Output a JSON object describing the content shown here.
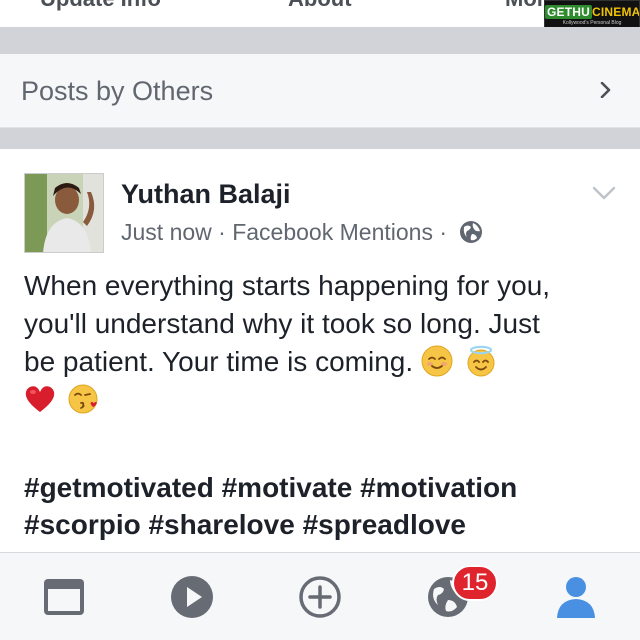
{
  "top_tabs": {
    "update_info": "Update Info",
    "about": "About",
    "more": "More"
  },
  "watermark": {
    "brand_g": "GETHU",
    "brand_c": "CINEMA",
    "tagline": "Kollywood's Personal Blog"
  },
  "posts_by_others": {
    "label": "Posts by Others"
  },
  "post": {
    "author": "Yuthan Balaji",
    "time": "Just now",
    "separator": "·",
    "source": "Facebook Mentions",
    "text_line1": "When everything starts happening for you,",
    "text_line2": "you'll understand why it took so long. Just",
    "text_line3": "be patient. Your time is coming.",
    "hashtags_line1": "#getmotivated #motivate #motivation",
    "hashtags_line2": "#scorpio #sharelove #spreadlove"
  },
  "tabbar": {
    "notifications_badge": "15",
    "accent_color": "#4a90e2",
    "icon_color": "#676b73"
  }
}
